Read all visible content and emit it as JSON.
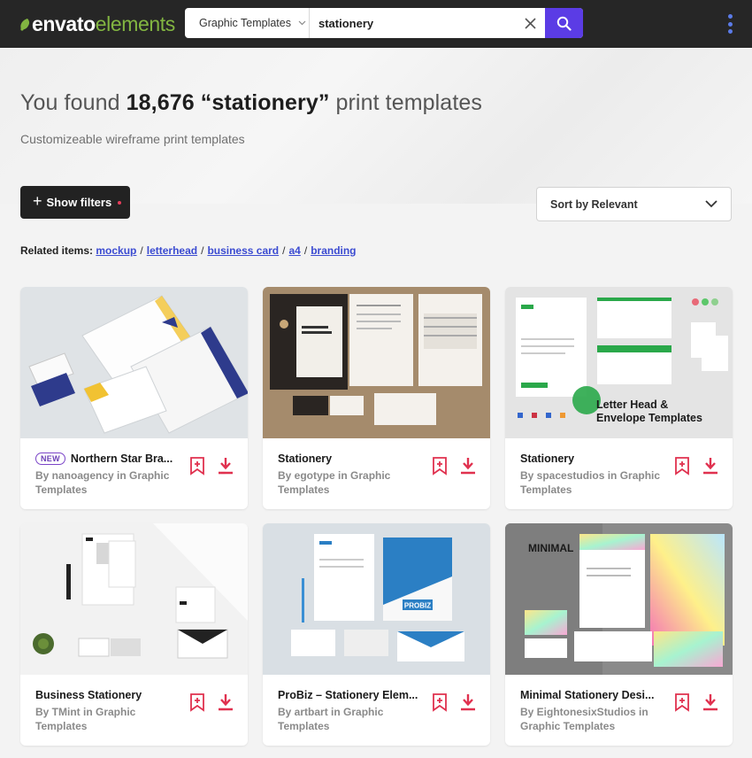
{
  "header": {
    "logo_part1": "envato",
    "logo_part2": "elements",
    "search_category": "Graphic Templates",
    "search_query": "stationery",
    "brand_accent": "#5b3ce5",
    "logo_green": "#82b541"
  },
  "hero": {
    "title_prefix": "You found",
    "title_count": "18,676 “stationery”",
    "title_suffix": "print templates",
    "subtitle": "Customizeable wireframe print templates",
    "filters_label": "Show filters",
    "sort_label": "Sort by Relevant"
  },
  "related": {
    "label": "Related items:",
    "items": [
      "mockup",
      "letterhead",
      "business card",
      "a4",
      "branding"
    ]
  },
  "cards": [
    {
      "badge": "NEW",
      "title": "Northern Star Bra...",
      "author_line1": "By nanoagency in Graphic",
      "author_line2": "Templates"
    },
    {
      "title": "Stationery",
      "author_line1": "By egotype in Graphic",
      "author_line2": "Templates"
    },
    {
      "title": "Stationery",
      "author_line1": "By spacestudios in Graphic",
      "author_line2": "Templates",
      "thumb_text1": "Letter Head &",
      "thumb_text2": "Envelope Templates"
    },
    {
      "title": "Business Stationery",
      "author_line1": "By TMint in Graphic",
      "author_line2": "Templates"
    },
    {
      "title": "ProBiz – Stationery Elem...",
      "author_line1": "By artbart in Graphic",
      "author_line2": "Templates",
      "thumb_text1": "PROBIZ"
    },
    {
      "title": "Minimal Stationery Desi...",
      "author_line1": "By EightonesixStudios in",
      "author_line2": "Graphic Templates",
      "thumb_text1": "MINIMAL"
    }
  ],
  "icons": {
    "bookmark": "bookmark-plus-icon",
    "download": "download-icon",
    "accent_red": "#e0314f"
  }
}
